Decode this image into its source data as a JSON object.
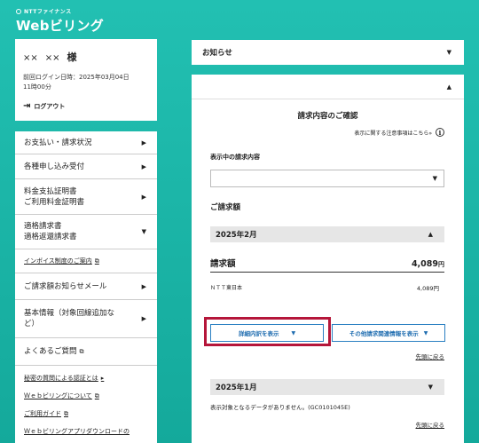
{
  "logo": {
    "sub": "NTTファイナンス",
    "main": "Webビリング"
  },
  "user": {
    "name_1": "××",
    "name_2": "××",
    "honorific": "様",
    "last_login_1": "前回ログイン日時：2025年03月04日",
    "last_login_2": "11時00分",
    "logout": "ログアウト"
  },
  "menu": {
    "payment": "お支払い・請求状況",
    "apply": "各種申し込み受付",
    "cert_1": "料金支払証明書",
    "cert_2": "ご利用料金証明書",
    "qualified_1": "適格請求書",
    "qualified_2": "適格返還請求書",
    "invoice_system": "インボイス制度のご案内",
    "mail": "ご請求額お知らせメール",
    "basic_1": "基本情報（対象回線追加な",
    "basic_2": "ど）",
    "faq": "よくあるご質問",
    "secret_auth": "秘密の質問による認証とは",
    "about": "Ｗｅｂビリングについて",
    "guide": "ご利用ガイド",
    "app": "Ｗｅｂビリングアプリダウンロードの"
  },
  "notice": {
    "title": "お知らせ"
  },
  "billing": {
    "title": "請求内容のご確認",
    "notes_link": "表示に関する注意事項はこちら»",
    "select_label": "表示中の請求内容",
    "amount_title": "ご請求額",
    "month1": "2025年2月",
    "total_label": "請求額",
    "total_value": "4,089",
    "yen": "円",
    "company": "ＮＴＴ東日本",
    "company_value": "4,089円",
    "detail_button": "詳細内訳を表示",
    "other_button": "その他請求関連情報を表示",
    "back_top": "先頭に戻る",
    "month2": "2025年1月",
    "no_data": "表示対象となるデータがありません。(GC0101045E)",
    "back_top_2": "先頭に戻る"
  },
  "colors": {
    "accent": "#1f6db0",
    "highlight": "#b5163a",
    "background": "#1fb8aa"
  }
}
